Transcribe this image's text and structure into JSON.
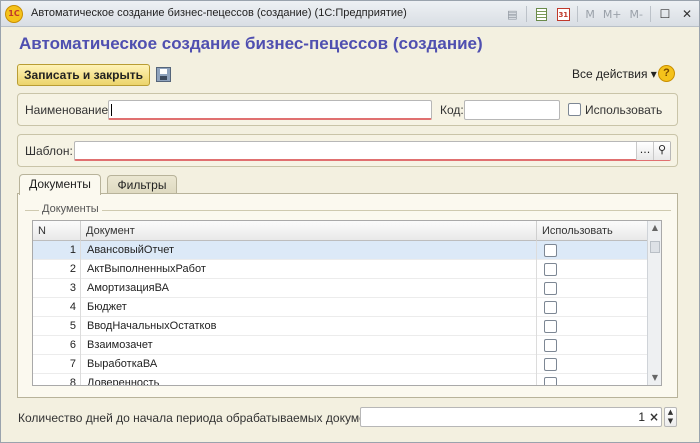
{
  "window": {
    "app_logo_text": "1С",
    "title": "Автоматическое создание бизнес-пецессов (создание)  (1С:Предприятие)",
    "toolbar": {
      "m_label": "M",
      "m_plus_label": "M+",
      "m_minus_label": "M-"
    }
  },
  "form": {
    "title": "Автоматическое создание бизнес-пецессов (создание)",
    "save_close_label": "Записать и закрыть",
    "all_actions_label": "Все действия ▾",
    "help_label": "?"
  },
  "fields": {
    "name_label": "Наименование:",
    "name_value": "",
    "code_label": "Код:",
    "code_value": "",
    "use_label": "Использовать",
    "use_checked": false,
    "template_label": "Шаблон:",
    "template_value": "",
    "template_select_label": "...",
    "template_search_icon": "search-icon"
  },
  "tabs": [
    {
      "label": "Документы",
      "active": true
    },
    {
      "label": "Фильтры",
      "active": false
    }
  ],
  "documents_group_label": "Документы",
  "table": {
    "columns": [
      "N",
      "Документ",
      "Использовать"
    ],
    "rows": [
      {
        "n": "1",
        "doc": "АвансовыйОтчет",
        "use": false
      },
      {
        "n": "2",
        "doc": "АктВыполненныхРабот",
        "use": false
      },
      {
        "n": "3",
        "doc": "АмортизацияВА",
        "use": false
      },
      {
        "n": "4",
        "doc": "Бюджет",
        "use": false
      },
      {
        "n": "5",
        "doc": "ВводНачальныхОстатков",
        "use": false
      },
      {
        "n": "6",
        "doc": "Взаимозачет",
        "use": false
      },
      {
        "n": "7",
        "doc": "ВыработкаВА",
        "use": false
      },
      {
        "n": "8",
        "doc": "Доверенность",
        "use": false
      }
    ],
    "selected_row": 0
  },
  "bottom": {
    "days_label": "Количество дней до начала периода обрабатываемых документов:",
    "days_value": "1",
    "clear_label": "×"
  },
  "colors": {
    "accent_title": "#4f4fb0",
    "save_button": "#ecd46b",
    "window_bg": "#f3f0e0"
  }
}
